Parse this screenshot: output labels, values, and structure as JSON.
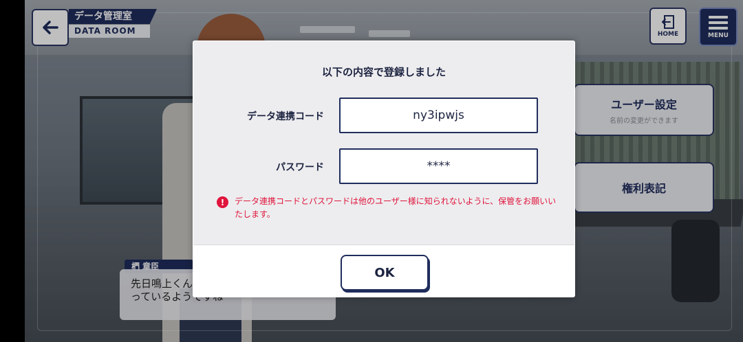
{
  "header": {
    "title_jp": "データ管理室",
    "title_en": "DATA ROOM"
  },
  "nav": {
    "home_label": "HOME",
    "menu_label": "MENU"
  },
  "side_menu": {
    "user_settings": {
      "label": "ユーザー設定",
      "sub": "名前の変更ができます"
    },
    "rights": {
      "label": "権利表記"
    }
  },
  "dialogue": {
    "speaker": "椚 章臣",
    "text": "先日鳴上くん…ずモデルと両立してがんばっているようですね"
  },
  "modal": {
    "title": "以下の内容で登録しました",
    "code_label": "データ連携コード",
    "code_value": "ny3ipwjs",
    "password_label": "パスワード",
    "password_value": "****",
    "warning": "データ連携コードとパスワードは他のユーザー様に知られないように、保管をお願いいたします。",
    "ok_label": "OK"
  },
  "colors": {
    "navy": "#1f2d5c",
    "warning_red": "#e0143c",
    "modal_bg": "#ededef"
  }
}
